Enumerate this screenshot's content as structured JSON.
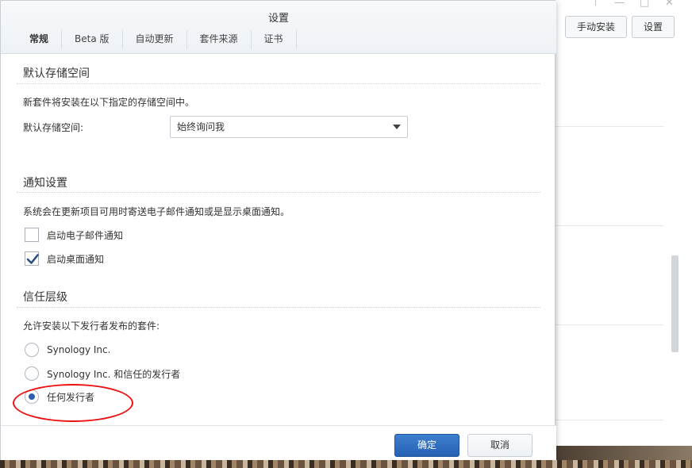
{
  "background_app": {
    "buttons": {
      "manual_install": "手动安装",
      "settings": "设置"
    },
    "window_controls": [
      "pin-icon",
      "minimize-icon",
      "maximize-icon",
      "close-icon"
    ]
  },
  "dialog": {
    "title": "设置",
    "tabs": [
      {
        "label": "常规",
        "active": true
      },
      {
        "label": "Beta 版",
        "active": false
      },
      {
        "label": "自动更新",
        "active": false
      },
      {
        "label": "套件来源",
        "active": false
      },
      {
        "label": "证书",
        "active": false
      }
    ],
    "storage": {
      "section_title": "默认存储空间",
      "description": "新套件将安装在以下指定的存储空间中。",
      "field_label": "默认存储空间:",
      "selected_value": "始终询问我"
    },
    "notifications": {
      "section_title": "通知设置",
      "description": "系统会在更新项目可用时寄送电子邮件通知或是显示桌面通知。",
      "options": [
        {
          "label": "启动电子邮件通知",
          "checked": false
        },
        {
          "label": "启动桌面通知",
          "checked": true
        }
      ]
    },
    "trust": {
      "section_title": "信任层级",
      "description": "允许安装以下发行者发布的套件:",
      "options": [
        {
          "label": "Synology Inc.",
          "selected": false
        },
        {
          "label": "Synology Inc. 和信任的发行者",
          "selected": false
        },
        {
          "label": "任何发行者",
          "selected": true
        }
      ]
    },
    "footer": {
      "ok_label": "确定",
      "cancel_label": "取消"
    }
  },
  "colors": {
    "primary_button": "#2f6cc2",
    "highlight_annotation": "#e11111",
    "radio_selected": "#2f5fa8"
  }
}
